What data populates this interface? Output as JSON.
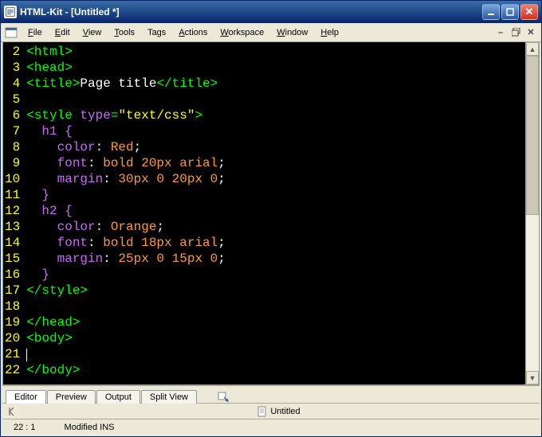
{
  "window": {
    "title": "HTML-Kit - [Untitled *]"
  },
  "menu": {
    "items": [
      {
        "label": "File",
        "key": "F"
      },
      {
        "label": "Edit",
        "key": "E"
      },
      {
        "label": "View",
        "key": "V"
      },
      {
        "label": "Tools",
        "key": "T"
      },
      {
        "label": "Tags",
        "key": ""
      },
      {
        "label": "Actions",
        "key": "A"
      },
      {
        "label": "Workspace",
        "key": "W"
      },
      {
        "label": "Window",
        "key": "W"
      },
      {
        "label": "Help",
        "key": "H"
      }
    ]
  },
  "editor": {
    "first_line": 2,
    "lines": [
      [
        {
          "c": "tok-g",
          "t": "<html>"
        }
      ],
      [
        {
          "c": "tok-g",
          "t": "<head>"
        }
      ],
      [
        {
          "c": "tok-g",
          "t": "<title>"
        },
        {
          "c": "tok-w",
          "t": "Page title"
        },
        {
          "c": "tok-g",
          "t": "</title>"
        }
      ],
      [],
      [
        {
          "c": "tok-g",
          "t": "<style "
        },
        {
          "c": "tok-p",
          "t": "type"
        },
        {
          "c": "tok-g",
          "t": "="
        },
        {
          "c": "tok-y",
          "t": "\"text/css\""
        },
        {
          "c": "tok-g",
          "t": ">"
        }
      ],
      [
        {
          "c": "tok-p",
          "t": "  h1 {"
        }
      ],
      [
        {
          "c": "tok-p",
          "t": "    color"
        },
        {
          "c": "tok-w",
          "t": ": "
        },
        {
          "c": "tok-o",
          "t": "Red"
        },
        {
          "c": "tok-w",
          "t": ";"
        }
      ],
      [
        {
          "c": "tok-p",
          "t": "    font"
        },
        {
          "c": "tok-w",
          "t": ": "
        },
        {
          "c": "tok-o",
          "t": "bold 20px arial"
        },
        {
          "c": "tok-w",
          "t": ";"
        }
      ],
      [
        {
          "c": "tok-p",
          "t": "    margin"
        },
        {
          "c": "tok-w",
          "t": ": "
        },
        {
          "c": "tok-o",
          "t": "30px 0 20px 0"
        },
        {
          "c": "tok-w",
          "t": ";"
        }
      ],
      [
        {
          "c": "tok-p",
          "t": "  }"
        }
      ],
      [
        {
          "c": "tok-p",
          "t": "  h2 {"
        }
      ],
      [
        {
          "c": "tok-p",
          "t": "    color"
        },
        {
          "c": "tok-w",
          "t": ": "
        },
        {
          "c": "tok-o",
          "t": "Orange"
        },
        {
          "c": "tok-w",
          "t": ";"
        }
      ],
      [
        {
          "c": "tok-p",
          "t": "    font"
        },
        {
          "c": "tok-w",
          "t": ": "
        },
        {
          "c": "tok-o",
          "t": "bold 18px arial"
        },
        {
          "c": "tok-w",
          "t": ";"
        }
      ],
      [
        {
          "c": "tok-p",
          "t": "    margin"
        },
        {
          "c": "tok-w",
          "t": ": "
        },
        {
          "c": "tok-o",
          "t": "25px 0 15px 0"
        },
        {
          "c": "tok-w",
          "t": ";"
        }
      ],
      [
        {
          "c": "tok-p",
          "t": "  }"
        }
      ],
      [
        {
          "c": "tok-g",
          "t": "</style>"
        }
      ],
      [],
      [
        {
          "c": "tok-g",
          "t": "</head>"
        }
      ],
      [
        {
          "c": "tok-g",
          "t": "<body>"
        }
      ],
      [
        {
          "c": "cursor",
          "t": ""
        }
      ],
      [
        {
          "c": "tok-g",
          "t": "</body>"
        }
      ]
    ]
  },
  "tabs": {
    "items": [
      "Editor",
      "Preview",
      "Output",
      "Split View"
    ],
    "active": 0
  },
  "docbar": {
    "title": "Untitled"
  },
  "statusbar": {
    "pos": "22 : 1",
    "state": "Modified INS"
  }
}
